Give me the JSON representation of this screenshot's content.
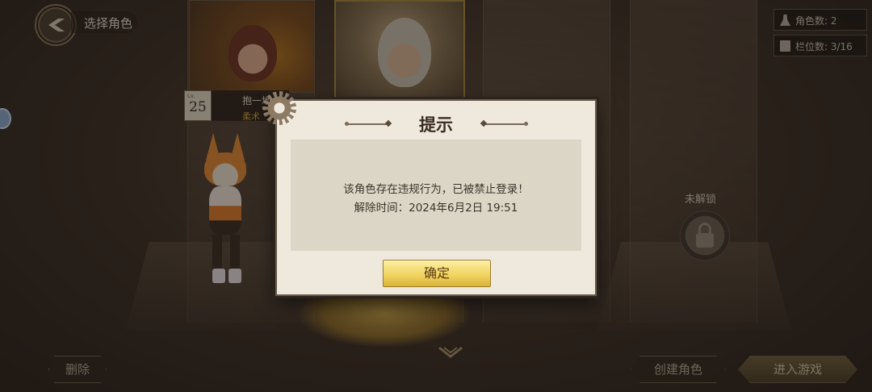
{
  "header": {
    "title": "选择角色",
    "back_icon": "chevron-left-emblem-icon"
  },
  "counters": {
    "character_count": "角色数: 2",
    "slot_count": "栏位数: 3/16"
  },
  "characters": [
    {
      "level_label": "Lv.",
      "level": "25",
      "name": "抱一地",
      "job": "柔术"
    }
  ],
  "locked_slot": {
    "label": "未解锁",
    "icon": "lock-icon"
  },
  "buttons": {
    "delete": "删除",
    "create": "创建角色",
    "enter": "进入游戏"
  },
  "dialog": {
    "title": "提示",
    "message_line1": "该角色存在违规行为，已被禁止登录！",
    "message_line2": "解除时间：2024年6月2日 19:51",
    "confirm": "确定"
  },
  "colors": {
    "dialog_bg": "#efe9dd",
    "dialog_body_bg": "#dcd6c6",
    "confirm_gold": "#f1d460",
    "job_color": "#d9a640"
  }
}
